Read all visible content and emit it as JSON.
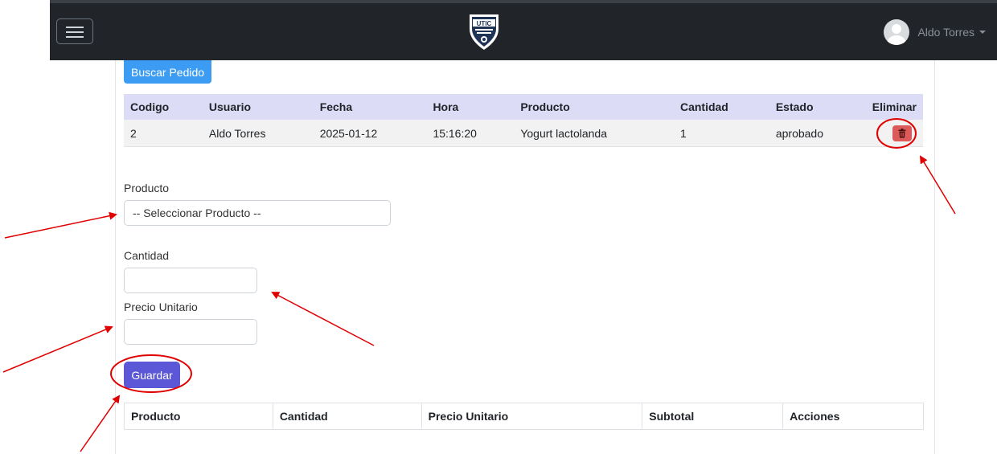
{
  "navbar": {
    "user_name": "Aldo Torres",
    "logo_text": "UTIC"
  },
  "search_button": "Buscar Pedido",
  "orders_table": {
    "headers": [
      "Codigo",
      "Usuario",
      "Fecha",
      "Hora",
      "Producto",
      "Cantidad",
      "Estado",
      "Eliminar"
    ],
    "rows": [
      [
        "2",
        "Aldo Torres",
        "2025-01-12",
        "15:16:20",
        "Yogurt lactolanda",
        "1",
        "aprobado"
      ]
    ]
  },
  "form": {
    "product_label": "Producto",
    "product_select_value": "-- Seleccionar Producto --",
    "quantity_label": "Cantidad",
    "quantity_value": "",
    "unit_price_label": "Precio Unitario",
    "unit_price_value": "",
    "save_button": "Guardar"
  },
  "detail_table": {
    "headers": [
      "Producto",
      "Cantidad",
      "Precio Unitario",
      "Subtotal",
      "Acciones"
    ]
  },
  "colors": {
    "navbar": "#212529",
    "primary": "#3c9bf2",
    "save": "#5b57d6",
    "danger": "#dc5a5a",
    "annotation": "#e00000"
  },
  "icons": [
    "menu-icon",
    "utic-logo",
    "user-avatar-icon",
    "caret-down-icon",
    "trash-icon"
  ]
}
